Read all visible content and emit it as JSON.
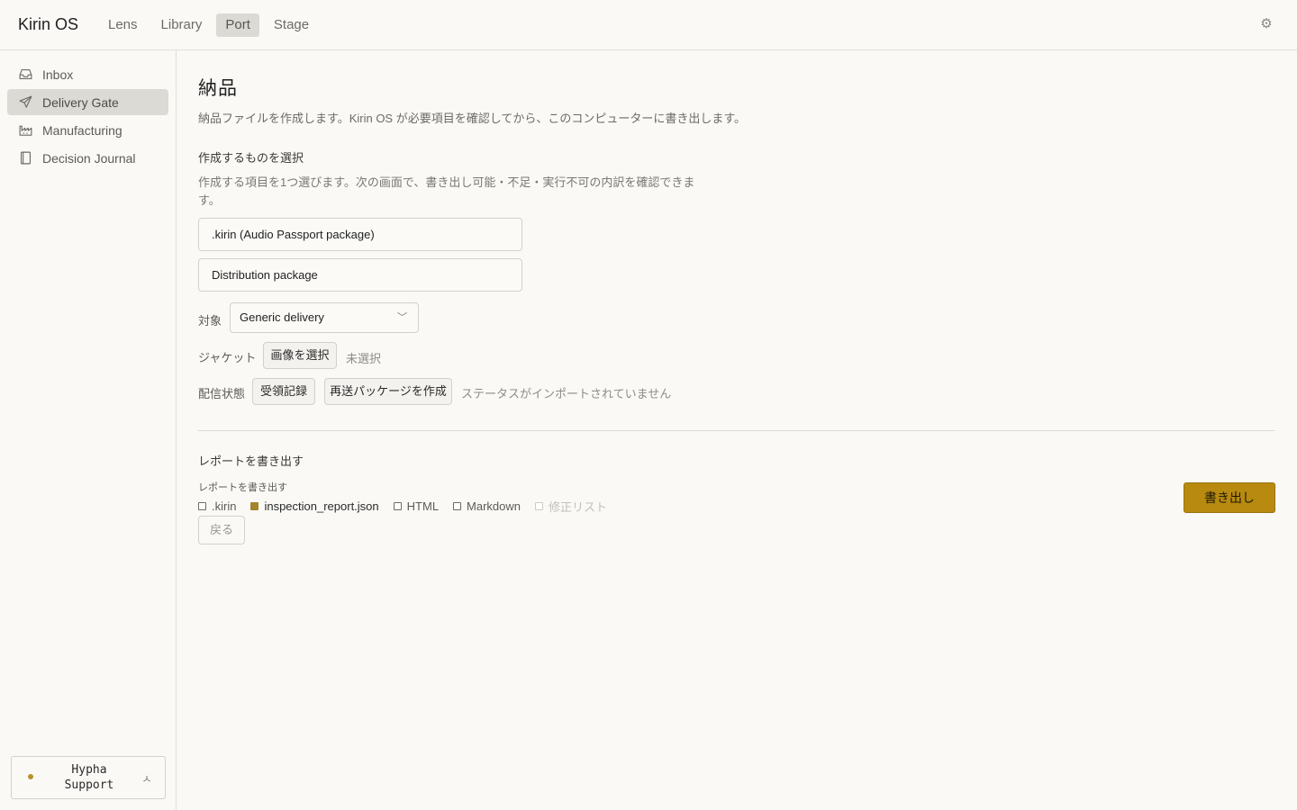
{
  "app": {
    "brand": "Kirin OS",
    "tabs": [
      {
        "label": "Lens"
      },
      {
        "label": "Library"
      },
      {
        "label": "Port"
      },
      {
        "label": "Stage"
      }
    ],
    "active_tab": "Port",
    "settings_icon": "gear-icon"
  },
  "sidebar": {
    "items": [
      {
        "label": "Inbox",
        "icon": "inbox-icon"
      },
      {
        "label": "Delivery Gate",
        "icon": "send-icon"
      },
      {
        "label": "Manufacturing",
        "icon": "factory-icon"
      },
      {
        "label": "Decision Journal",
        "icon": "journal-icon"
      }
    ],
    "active_item": "Delivery Gate",
    "support": {
      "line1": "Hypha",
      "line2": "Support",
      "caret": "^"
    }
  },
  "main": {
    "title": "納品",
    "subtitle": "納品ファイルを作成します。Kirin OS が必要項目を確認してから、このコンピューターに書き出します。",
    "select_heading": "作成するものを選択",
    "select_desc": "作成する項目を1つ選びます。次の画面で、書き出し可能・不足・実行不可の内訳を確認できます。",
    "choices": [
      {
        "label": ".kirin (Audio Passport package)"
      },
      {
        "label": "Distribution package"
      }
    ],
    "target": {
      "label": "対象",
      "value": "Generic delivery"
    },
    "jacket": {
      "label": "ジャケット",
      "button": "画像を選択",
      "status": "未選択"
    },
    "delivery": {
      "label": "配信状態",
      "receipt_button": "受領記録",
      "resend_button": "再送パッケージを作成",
      "status": "ステータスがインポートされていません"
    },
    "report": {
      "heading": "レポートを書き出す",
      "subheading": "レポートを書き出す",
      "options": [
        {
          "label": ".kirin",
          "checked": false,
          "disabled": false
        },
        {
          "label": "inspection_report.json",
          "checked": true,
          "disabled": false
        },
        {
          "label": "HTML",
          "checked": false,
          "disabled": false
        },
        {
          "label": "Markdown",
          "checked": false,
          "disabled": false
        },
        {
          "label": "修正リスト",
          "checked": false,
          "disabled": true
        }
      ],
      "back_button": "戻る",
      "export_button": "書き出し"
    }
  },
  "colors": {
    "accent": "#b88a0f",
    "background": "#faf9f6",
    "border": "#d4d1ca"
  }
}
